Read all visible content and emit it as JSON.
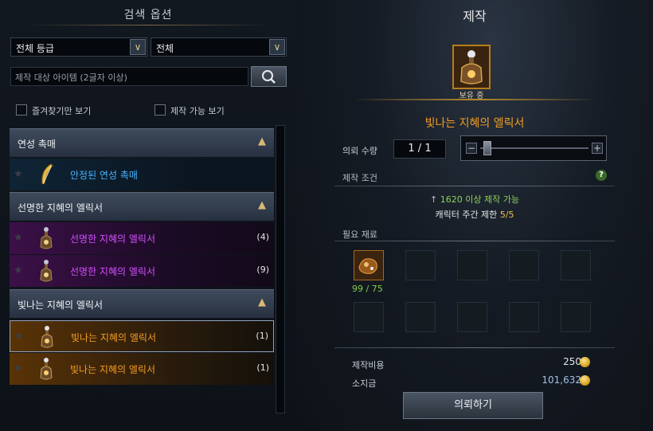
{
  "left_panel": {
    "title": "검색 옵션",
    "grade_select": "전체 등급",
    "type_select": "전체",
    "search_placeholder": "제작 대상 아이템 (2글자 이상)",
    "favorites_only": "즐겨찾기만 보기",
    "craftable_only": "제작 가능 보기",
    "categories": [
      {
        "title": "연성 촉매",
        "items": [
          {
            "name": "안정된 연성 촉매",
            "count": "",
            "rarity": "blue"
          }
        ]
      },
      {
        "title": "선명한 지혜의 엘릭서",
        "items": [
          {
            "name": "선명한 지혜의 엘릭서",
            "count": "(4)",
            "rarity": "purple"
          },
          {
            "name": "선명한 지혜의 엘릭서",
            "count": "(9)",
            "rarity": "purple"
          }
        ]
      },
      {
        "title": "빛나는 지혜의 엘릭서",
        "items": [
          {
            "name": "빛나는 지혜의 엘릭서",
            "count": "(1)",
            "rarity": "orange"
          },
          {
            "name": "빛나는 지혜의 엘릭서",
            "count": "(1)",
            "rarity": "orange"
          }
        ]
      }
    ]
  },
  "right_panel": {
    "title": "제작",
    "owned_label": "보유 중",
    "item_name": "빛나는 지혜의 엘릭서",
    "quantity_label": "의뢰 수량",
    "quantity_value": "1 / 1",
    "conditions_label": "제작 조건",
    "condition_level": "1620 이상 제작 가능",
    "condition_weekly_prefix": "캐릭터 주간 제한 ",
    "condition_weekly_value": "5/5",
    "materials_label": "필요 재료",
    "material_count": "99 / 75",
    "cost_label": "제작비용",
    "cost_value": "250",
    "money_label": "소지금",
    "money_value": "101,632",
    "request_button": "의뢰하기"
  },
  "colors": {
    "blue_item": "#48b4ff",
    "purple_item": "#d250ff",
    "orange_item": "#f29c24",
    "accent_gold": "#d8b974",
    "green_text": "#8ed35a"
  },
  "icons": [
    "search-icon",
    "chevron-down-icon",
    "chevron-up-icon",
    "star-icon",
    "feather-icon",
    "potion-icon",
    "ore-icon",
    "coin-icon",
    "help-icon"
  ]
}
